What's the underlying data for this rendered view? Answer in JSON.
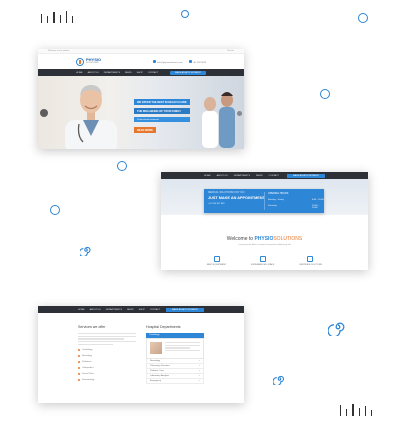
{
  "decor": {
    "accent_color": "#2e86d6",
    "tick_color": "#333333",
    "icons": [
      "ring-icon",
      "swirl-icon",
      "tick-marks"
    ]
  },
  "screenshot_home": {
    "topbar_left": "Welcome to our website",
    "topbar_right": "Find us",
    "logo_name": "PHYSIO",
    "logo_sub": "SOLUTIONS",
    "contact_email": "info@physiosolutions.com",
    "contact_phone": "+01 234 5678",
    "nav_items": [
      "HOME",
      "ABOUT US",
      "DEPARTMENTS",
      "NEWS",
      "SHOP",
      "CONTACT"
    ],
    "nav_button": "MAKE AN APPOINTMENT",
    "hero_captions": [
      "WE OFFER THE BEST IN HEALTH CARE",
      "THE WELLBEING OF YOUR FAMILY",
      "Professional treatment"
    ],
    "hero_button": "READ MORE"
  },
  "screenshot_appointment": {
    "nav_items": [
      "HOME",
      "ABOUT US",
      "DEPARTMENTS",
      "NEWS",
      "CONTACT"
    ],
    "nav_button": "MAKE AN APPOINTMENT",
    "appt_small": "MEDICAL SOLUTIONS FOR YOU",
    "appt_title": "JUST MAKE AN APPOINTMENT",
    "appt_phone": "+01 234 567 890",
    "appt_right_title": "OPENING HOURS",
    "appt_rows": [
      {
        "label": "Monday - Friday",
        "value": "8.00 - 18.00"
      },
      {
        "label": "Saturday",
        "value": "10.00 - 14.00"
      }
    ],
    "welcome_prefix": "Welcome to",
    "welcome_brand": "PHYSIO",
    "welcome_brand2": "SOLUTIONS",
    "welcome_sub": "Lorem ipsum dolor sit amet consectetur adipiscing elit",
    "features": [
      "BEST EQUIPMENT",
      "EXPERIENCED STAFF",
      "CERTIFIED DOCTORS"
    ]
  },
  "screenshot_departments": {
    "nav_items": [
      "HOME",
      "ABOUT US",
      "DEPARTMENTS",
      "NEWS",
      "SHOP",
      "CONTACT"
    ],
    "nav_button": "MAKE AN APPOINTMENT",
    "services_title": "Services we offer",
    "services": [
      "Cardiology",
      "Neurology",
      "Pediatrics",
      "Orthopedics",
      "Dental Clinic",
      "Dermatology"
    ],
    "departments_title": "Hospital Departments",
    "dept_head": "Cardiology",
    "dept_rows": [
      "Neurology",
      "Pulmonary Function",
      "Pediatric Care",
      "Laboratory Analysis",
      "Emergency"
    ]
  }
}
